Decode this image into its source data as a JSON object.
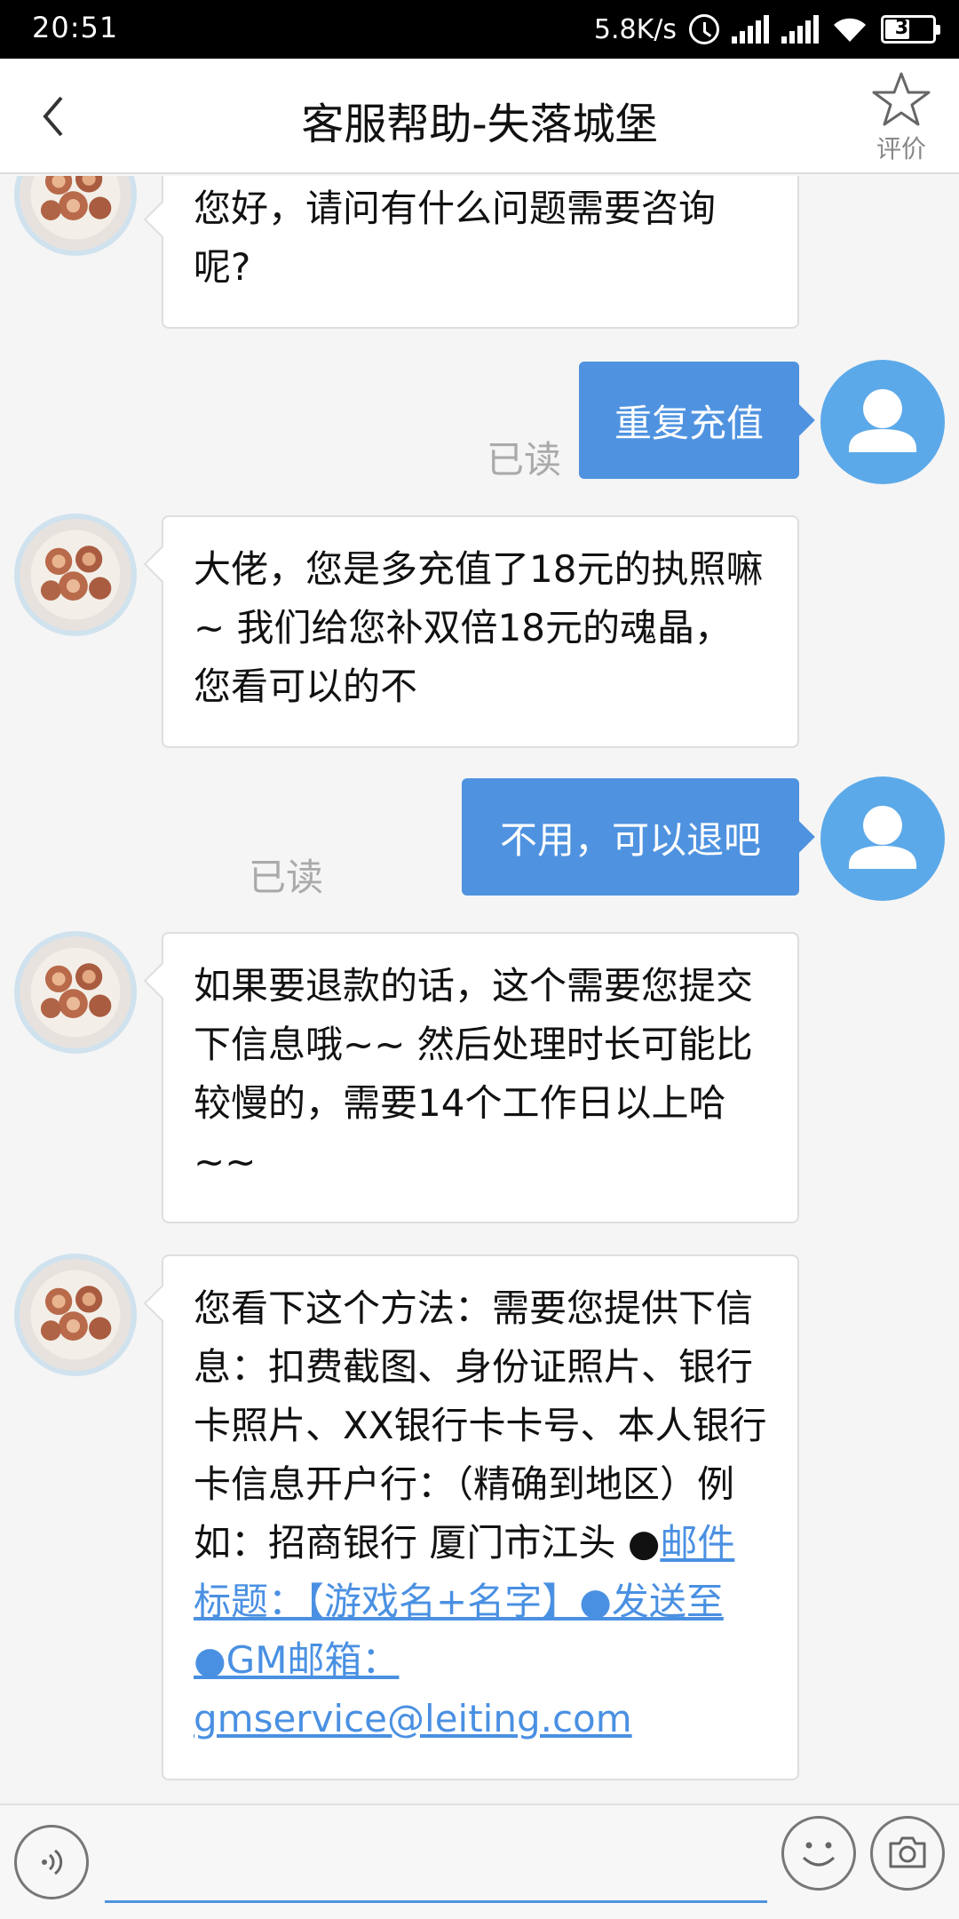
{
  "status_bar": {
    "time": "20:51",
    "net_speed": "5.8K/s",
    "battery": "32"
  },
  "header": {
    "title": "客服帮助-失落城堡",
    "rate_label": "评价"
  },
  "messages": [
    {
      "sender": "agent",
      "text": "您好，请问有什么问题需要咨询呢?"
    },
    {
      "sender": "user",
      "text": "重复充值",
      "status": "已读"
    },
    {
      "sender": "agent",
      "text": "大佬，您是多充值了18元的执照嘛~ 我们给您补双倍18元的魂晶，您看可以的不"
    },
    {
      "sender": "user",
      "text": "不用，可以退吧",
      "status": "已读"
    },
    {
      "sender": "agent",
      "text": "如果要退款的话，这个需要您提交下信息哦~~ 然后处理时长可能比较慢的，需要14个工作日以上哈~~"
    },
    {
      "sender": "agent",
      "text": "您看下这个方法：需要您提供下信息：扣费截图、身份证照片、银行卡照片、XX银行卡卡号、本人银行卡信息开户行：（精确到地区）例如：招商银行 厦门市江头 ●",
      "link": "邮件标题：【游戏名+名字】●发送至●GM邮箱：gmservice@leiting.com"
    }
  ],
  "input": {
    "placeholder": ""
  },
  "colors": {
    "accent": "#4f93e0",
    "user_avatar": "#5ca9e9",
    "link": "#4a90e2"
  },
  "icons": {
    "back": "chevron-left-icon",
    "rate": "star-icon",
    "voice": "voice-icon",
    "emoji": "smiley-icon",
    "camera": "camera-icon"
  }
}
